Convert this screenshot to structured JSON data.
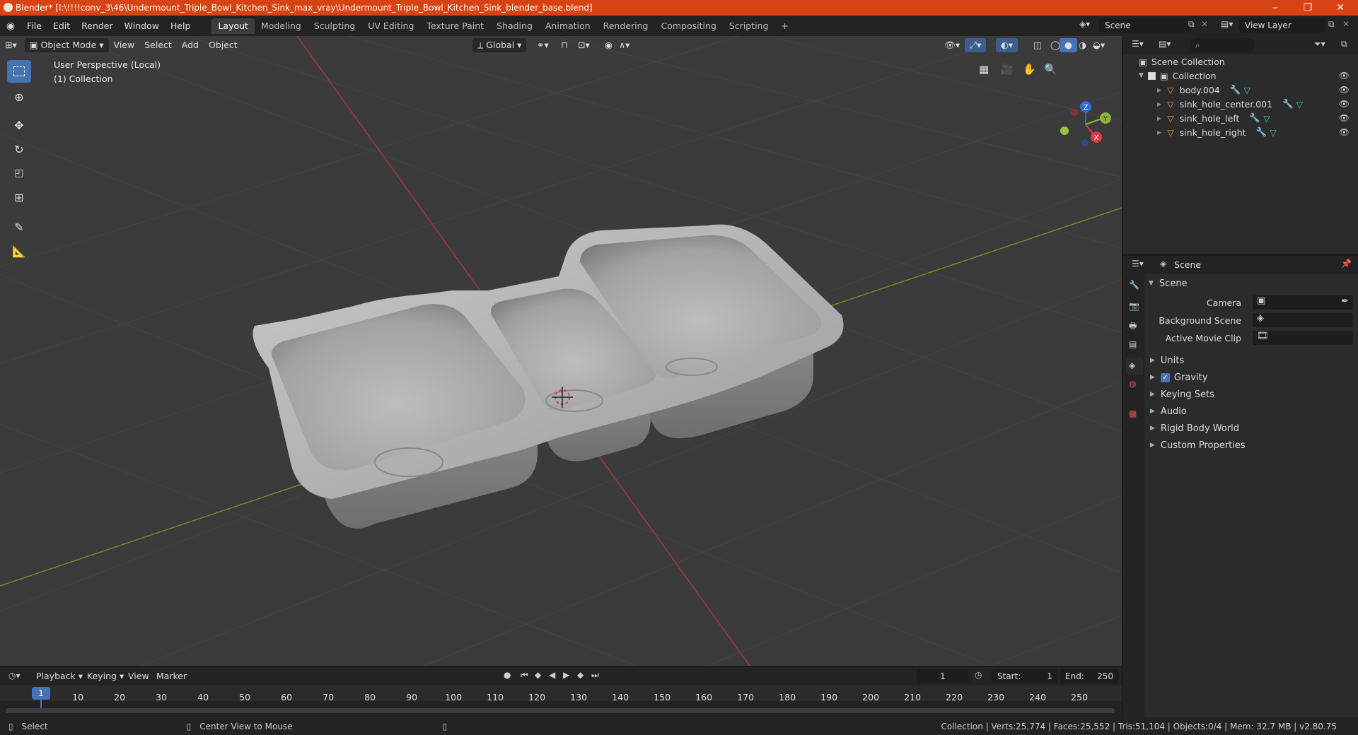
{
  "window": {
    "title": "Blender* [I:\\!!!!conv_3\\46\\Undermount_Triple_Bowl_Kitchen_Sink_max_vray\\Undermount_Triple_Bowl_Kitchen_Sink_blender_base.blend]",
    "controls": {
      "minimize": "–",
      "maximize": "❐",
      "close": "✕"
    }
  },
  "menu": {
    "items": [
      "File",
      "Edit",
      "Render",
      "Window",
      "Help"
    ],
    "workspaces": [
      "Layout",
      "Modeling",
      "Sculpting",
      "UV Editing",
      "Texture Paint",
      "Shading",
      "Animation",
      "Rendering",
      "Compositing",
      "Scripting"
    ],
    "active_workspace": "Layout",
    "add_tab": "+",
    "scene": "Scene",
    "view_layer": "View Layer"
  },
  "viewport": {
    "mode": "Object Mode",
    "menus": [
      "View",
      "Select",
      "Add",
      "Object"
    ],
    "orientation": "Global",
    "perspective_label": "User Perspective (Local)",
    "collection_label": "(1) Collection",
    "gizmo": {
      "x": "X",
      "y": "Y",
      "z": "Z"
    }
  },
  "outliner": {
    "search_placeholder": "",
    "root": "Scene Collection",
    "collection": "Collection",
    "objects": [
      "body.004",
      "sink_hole_center.001",
      "sink_hole_left",
      "sink_hole_right"
    ]
  },
  "properties": {
    "header": "Scene",
    "section": "Scene",
    "fields": [
      {
        "label": "Camera",
        "value": ""
      },
      {
        "label": "Background Scene",
        "value": ""
      },
      {
        "label": "Active Movie Clip",
        "value": ""
      }
    ],
    "panels": [
      "Units",
      "Gravity",
      "Keying Sets",
      "Audio",
      "Rigid Body World",
      "Custom Properties"
    ],
    "gravity_checked": true
  },
  "timeline": {
    "menus": [
      "Playback",
      "Keying",
      "View",
      "Marker"
    ],
    "current_frame": "1",
    "start_label": "Start:",
    "start": "1",
    "end_label": "End:",
    "end": "250",
    "ticks": [
      "1",
      "10",
      "20",
      "30",
      "40",
      "50",
      "60",
      "70",
      "80",
      "90",
      "100",
      "110",
      "120",
      "130",
      "140",
      "150",
      "160",
      "170",
      "180",
      "190",
      "200",
      "210",
      "220",
      "230",
      "240",
      "250"
    ]
  },
  "status": {
    "select": "Select",
    "center_view": "Center View to Mouse",
    "stats": "Collection | Verts:25,774 | Faces:25,552 | Tris:51,104 | Objects:0/4 | Mem: 32.7 MB | v2.80.75"
  },
  "colors": {
    "title_bar": "#d84313",
    "accent": "#4772b3",
    "viewport_bg": "#3b3b3b",
    "x_axis": "#a8333a",
    "y_axis": "#6b8e23"
  }
}
